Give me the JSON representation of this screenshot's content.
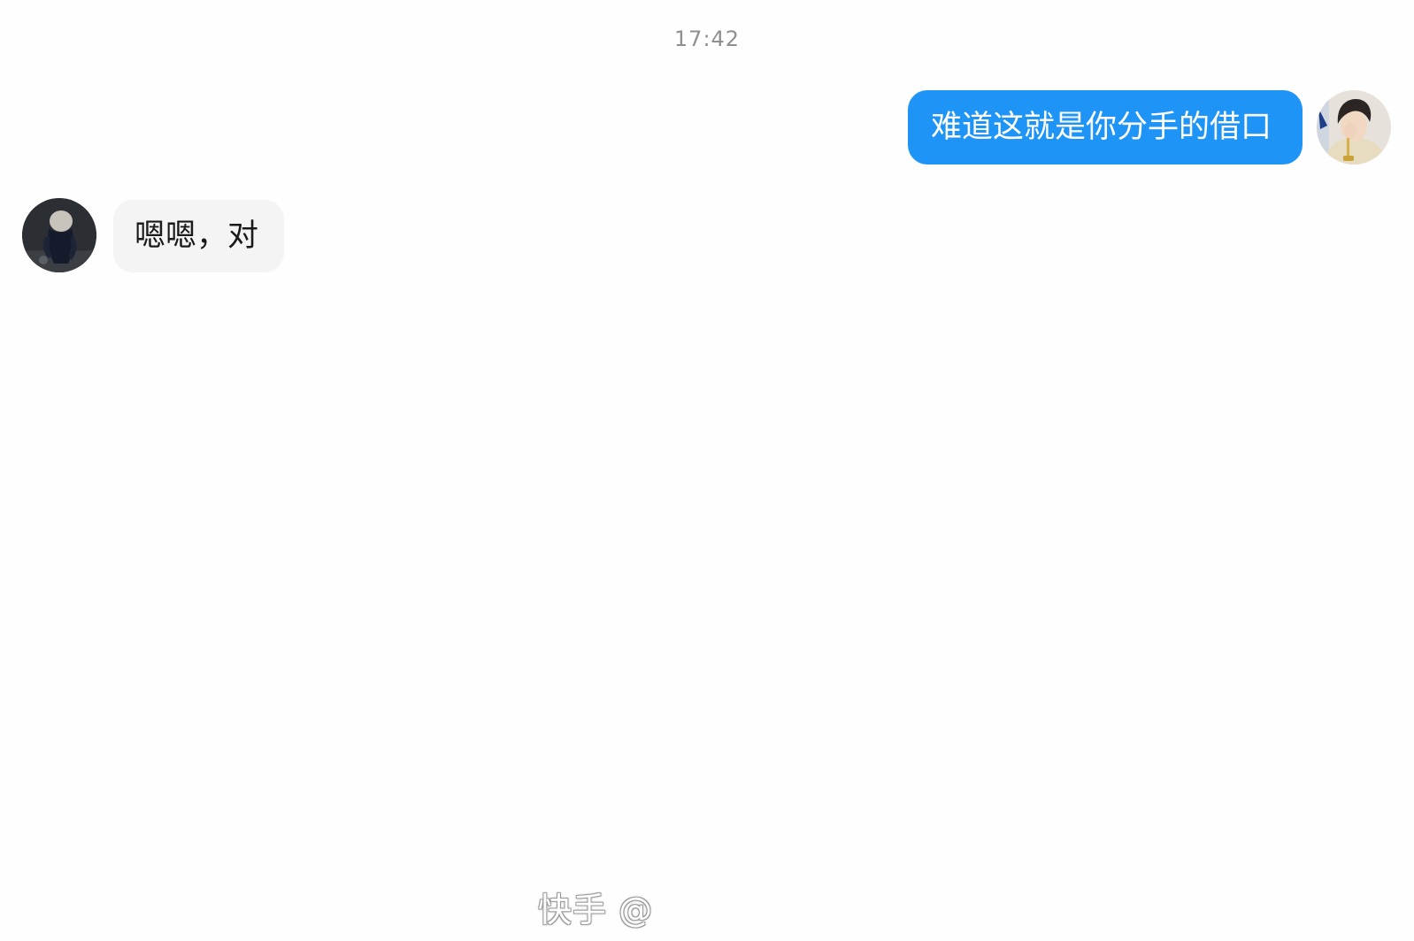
{
  "chat": {
    "timestamp": "17:42",
    "messages": [
      {
        "direction": "sent",
        "text": "难道这就是你分手的借口",
        "bubble_color": "#1e95f6",
        "avatar": "user-photo-avatar"
      },
      {
        "direction": "received",
        "text": "嗯嗯，对",
        "bubble_color": "#f5f4f4",
        "avatar": "contact-photo-avatar"
      }
    ]
  },
  "watermark": {
    "text": "快手 @"
  }
}
